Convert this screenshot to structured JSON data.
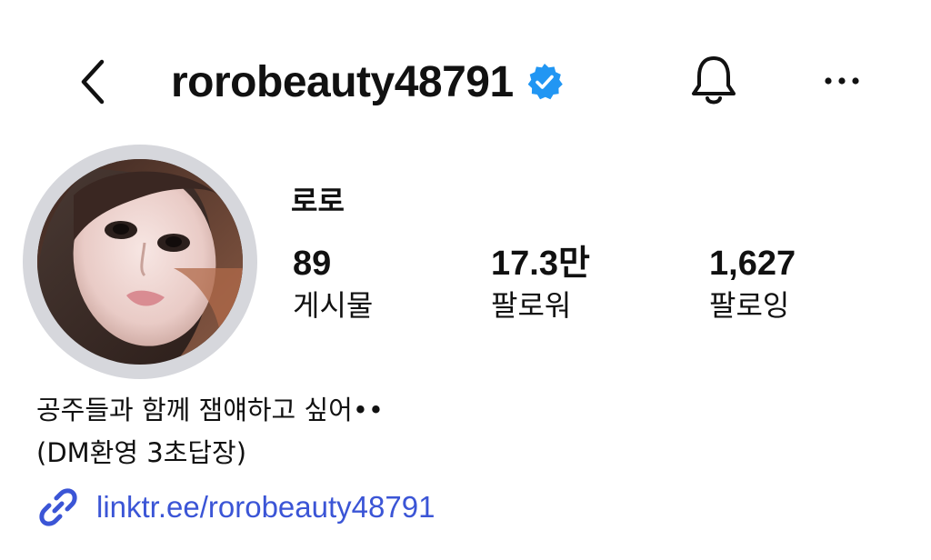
{
  "header": {
    "username": "rorobeauty48791",
    "back_icon": "chevron-left-icon",
    "verified_icon": "verified-badge-icon",
    "bell_icon": "bell-icon",
    "more_icon": "more-horizontal-icon"
  },
  "profile": {
    "name": "로로",
    "stats": [
      {
        "value": "89",
        "label": "게시물"
      },
      {
        "value": "17.3만",
        "label": "팔로워"
      },
      {
        "value": "1,627",
        "label": "팔로잉"
      }
    ],
    "bio_lines": [
      "공주들과 함께 잼얘하고 싶어••",
      "(DM환영 3초답장)"
    ],
    "link_icon": "link-icon",
    "link": "linktr.ee/rorobeauty48791"
  },
  "colors": {
    "verified": "#2196f3",
    "link": "#3b55d6",
    "avatar_ring": "#d6d7dc"
  }
}
